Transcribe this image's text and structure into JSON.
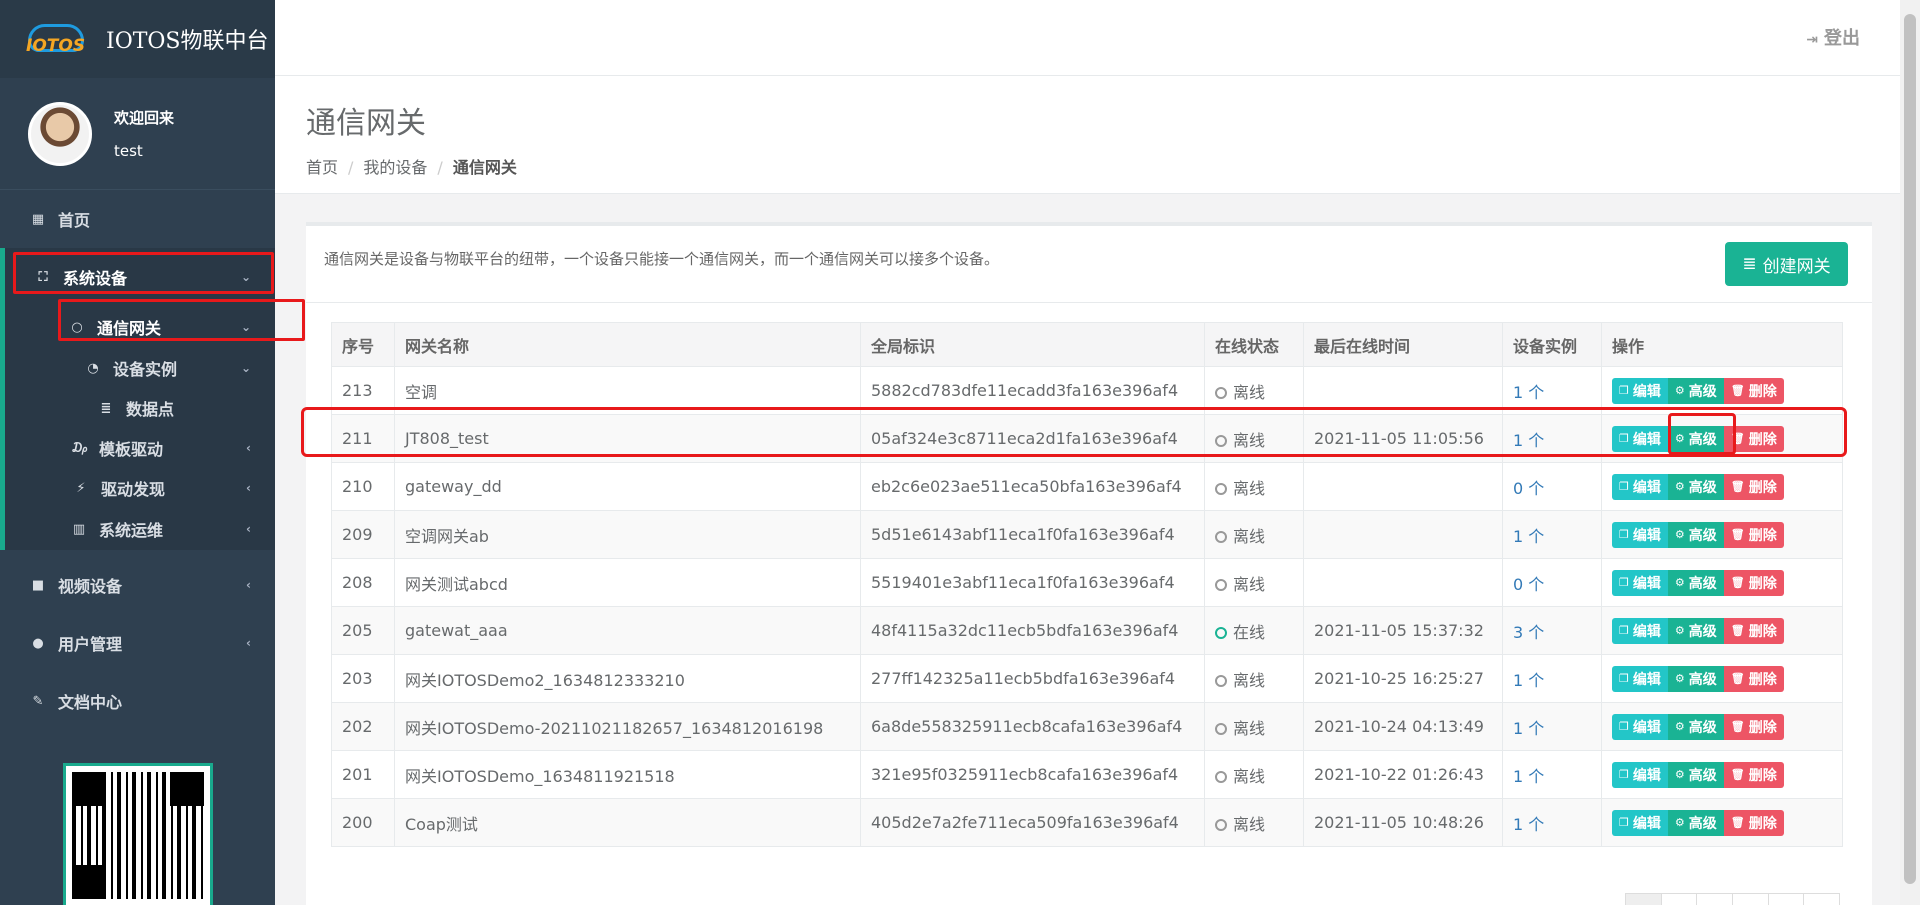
{
  "app": {
    "brand": "IOTOS物联中台",
    "logo_text": "IOTOS"
  },
  "profile": {
    "welcome": "欢迎回来",
    "username": "test"
  },
  "sidebar": {
    "home": "首页",
    "system_devices": "系统设备",
    "gateway": "通信网关",
    "device_instance": "设备实例",
    "data_points": "数据点",
    "template_driver": "模板驱动",
    "driver_discovery": "驱动发现",
    "system_ops": "系统运维",
    "video_devices": "视频设备",
    "user_management": "用户管理",
    "docs_center": "文档中心"
  },
  "topbar": {
    "logout": "登出"
  },
  "page": {
    "title": "通信网关",
    "breadcrumb": [
      "首页",
      "我的设备",
      "通信网关"
    ],
    "intro": "通信网关是设备与物联平台的纽带，一个设备只能接一个通信网关，而一个通信网关可以接多个设备。",
    "create_button": "创建网关"
  },
  "table": {
    "headers": [
      "序号",
      "网关名称",
      "全局标识",
      "在线状态",
      "最后在线时间",
      "设备实例",
      "操作"
    ],
    "ops": {
      "edit": "编辑",
      "advanced": "高级",
      "delete": "删除"
    },
    "rows": [
      {
        "id": "213",
        "name": "空调",
        "uid": "5882cd783dfe11ecadd3fa163e396af4",
        "status": "离线",
        "online": false,
        "last": "",
        "instances": "1 个"
      },
      {
        "id": "211",
        "name": "JT808_test",
        "uid": "05af324e3c8711eca2d1fa163e396af4",
        "status": "离线",
        "online": false,
        "last": "2021-11-05 11:05:56",
        "instances": "1 个"
      },
      {
        "id": "210",
        "name": "gateway_dd",
        "uid": "eb2c6e023ae511eca50bfa163e396af4",
        "status": "离线",
        "online": false,
        "last": "",
        "instances": "0 个"
      },
      {
        "id": "209",
        "name": "空调网关ab",
        "uid": "5d51e6143abf11eca1f0fa163e396af4",
        "status": "离线",
        "online": false,
        "last": "",
        "instances": "1 个"
      },
      {
        "id": "208",
        "name": "网关测试abcd",
        "uid": "5519401e3abf11eca1f0fa163e396af4",
        "status": "离线",
        "online": false,
        "last": "",
        "instances": "0 个"
      },
      {
        "id": "205",
        "name": "gatewat_aaa",
        "uid": "48f4115a32dc11ecb5bdfa163e396af4",
        "status": "在线",
        "online": true,
        "last": "2021-11-05 15:37:32",
        "instances": "3 个"
      },
      {
        "id": "203",
        "name": "网关IOTOSDemo2_1634812333210",
        "uid": "277ff142325a11ecb5bdfa163e396af4",
        "status": "离线",
        "online": false,
        "last": "2021-10-25 16:25:27",
        "instances": "1 个"
      },
      {
        "id": "202",
        "name": "网关IOTOSDemo-20211021182657_1634812016198",
        "uid": "6a8de558325911ecb8cafa163e396af4",
        "status": "离线",
        "online": false,
        "last": "2021-10-24 04:13:49",
        "instances": "1 个"
      },
      {
        "id": "201",
        "name": "网关IOTOSDemo_1634811921518",
        "uid": "321e95f0325911ecb8cafa163e396af4",
        "status": "离线",
        "online": false,
        "last": "2021-10-22 01:26:43",
        "instances": "1 个"
      },
      {
        "id": "200",
        "name": "Coap测试",
        "uid": "405d2e7a2fe711eca509fa163e396af4",
        "status": "离线",
        "online": false,
        "last": "2021-11-05 10:48:26",
        "instances": "1 个"
      }
    ]
  },
  "colors": {
    "sidebar": "#2f4050",
    "accent": "#1ab394",
    "edit": "#23c6c8",
    "delete": "#ed5565",
    "highlight": "#e8191b"
  }
}
